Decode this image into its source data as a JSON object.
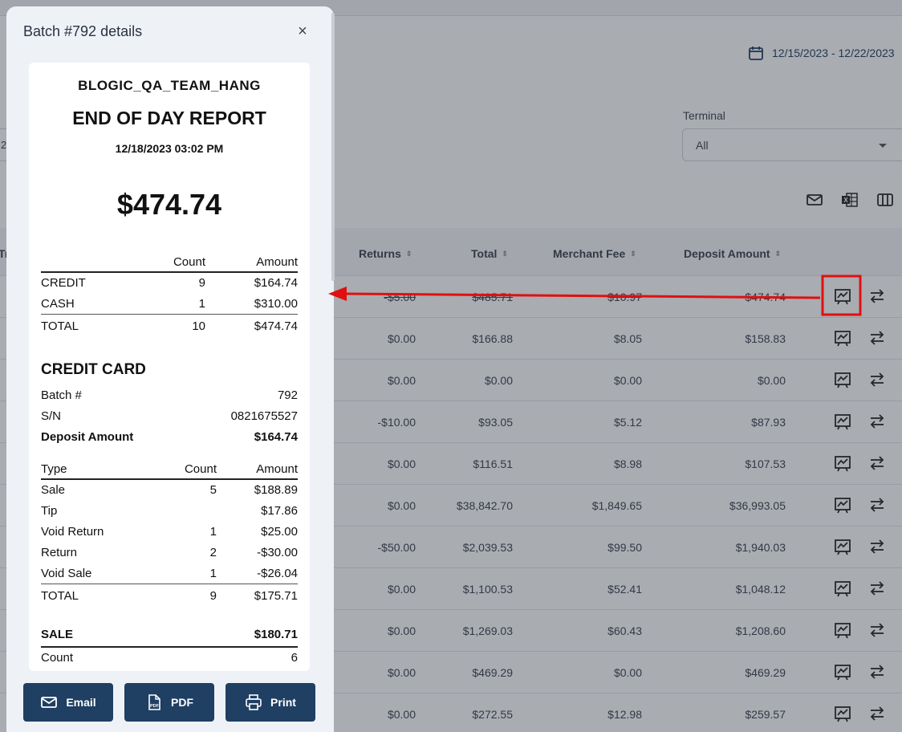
{
  "background": {
    "date_range": "12/15/2023 - 12/22/2023",
    "terminal_label": "Terminal",
    "terminal_value": "All",
    "left_input_partial": "2",
    "left_header_partial": "Tr",
    "columns": [
      "Returns",
      "Total",
      "Merchant Fee",
      "Deposit Amount"
    ],
    "rows": [
      {
        "returns": "-$5.00",
        "total": "$485.71",
        "fee": "$10.97",
        "deposit": "$474.74"
      },
      {
        "returns": "$0.00",
        "total": "$166.88",
        "fee": "$8.05",
        "deposit": "$158.83"
      },
      {
        "returns": "$0.00",
        "total": "$0.00",
        "fee": "$0.00",
        "deposit": "$0.00"
      },
      {
        "returns": "-$10.00",
        "total": "$93.05",
        "fee": "$5.12",
        "deposit": "$87.93"
      },
      {
        "returns": "$0.00",
        "total": "$116.51",
        "fee": "$8.98",
        "deposit": "$107.53"
      },
      {
        "returns": "$0.00",
        "total": "$38,842.70",
        "fee": "$1,849.65",
        "deposit": "$36,993.05"
      },
      {
        "returns": "-$50.00",
        "total": "$2,039.53",
        "fee": "$99.50",
        "deposit": "$1,940.03"
      },
      {
        "returns": "$0.00",
        "total": "$1,100.53",
        "fee": "$52.41",
        "deposit": "$1,048.12"
      },
      {
        "returns": "$0.00",
        "total": "$1,269.03",
        "fee": "$60.43",
        "deposit": "$1,208.60"
      },
      {
        "returns": "$0.00",
        "total": "$469.29",
        "fee": "$0.00",
        "deposit": "$469.29"
      },
      {
        "returns": "$0.00",
        "total": "$272.55",
        "fee": "$12.98",
        "deposit": "$259.57"
      }
    ]
  },
  "modal": {
    "title": "Batch #792 details",
    "close": "×",
    "receipt": {
      "merchant": "BLOGIC_QA_TEAM_HANG",
      "report_title": "END OF DAY REPORT",
      "datetime": "12/18/2023 03:02 PM",
      "grand_total": "$474.74",
      "summary_header": {
        "count": "Count",
        "amount": "Amount"
      },
      "summary_rows": [
        {
          "label": "CREDIT",
          "count": "9",
          "amount": "$164.74"
        },
        {
          "label": "CASH",
          "count": "1",
          "amount": "$310.00"
        }
      ],
      "summary_total": {
        "label": "TOTAL",
        "count": "10",
        "amount": "$474.74"
      },
      "credit_title": "CREDIT CARD",
      "batch_label": "Batch #",
      "batch_value": "792",
      "sn_label": "S/N",
      "sn_value": "0821675527",
      "deposit_label": "Deposit Amount",
      "deposit_value": "$164.74",
      "type_header": {
        "type": "Type",
        "count": "Count",
        "amount": "Amount"
      },
      "type_rows": [
        {
          "type": "Sale",
          "count": "5",
          "amount": "$188.89"
        },
        {
          "type": "Tip",
          "count": "",
          "amount": "$17.86"
        },
        {
          "type": "Void Return",
          "count": "1",
          "amount": "$25.00"
        },
        {
          "type": "Return",
          "count": "2",
          "amount": "-$30.00"
        },
        {
          "type": "Void Sale",
          "count": "1",
          "amount": "-$26.04"
        }
      ],
      "type_total": {
        "type": "TOTAL",
        "count": "9",
        "amount": "$175.71"
      },
      "sale_label": "SALE",
      "sale_value": "$180.71",
      "count_label": "Count",
      "count_value": "6"
    },
    "buttons": {
      "email": "Email",
      "pdf": "PDF",
      "print": "Print"
    }
  },
  "colors": {
    "accent": "#1f3f63",
    "annotation": "#e01010"
  }
}
